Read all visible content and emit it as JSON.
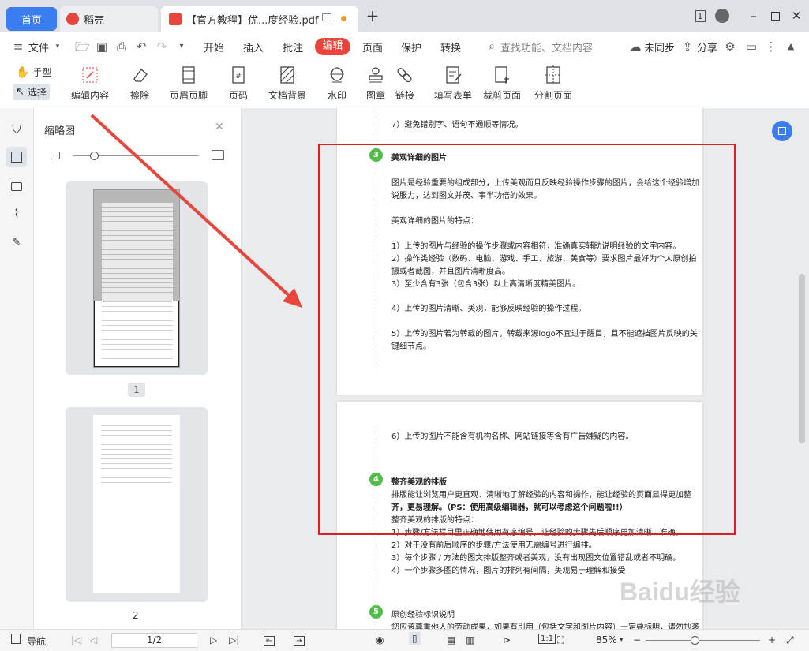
{
  "tabs": {
    "home": "首页",
    "docer": "稻壳",
    "pdf": "【官方教程】优...度经验.pdf"
  },
  "menu": {
    "file": "文件",
    "items": [
      "开始",
      "插入",
      "批注",
      "编辑",
      "页面",
      "保护",
      "转换"
    ],
    "search_placeholder": "查找功能、文档内容",
    "sync": "未同步",
    "share": "分享"
  },
  "tools": {
    "hand": "手型",
    "select": "选择",
    "ribbon": [
      "编辑内容",
      "擦除",
      "页眉页脚",
      "页码",
      "文档背景",
      "水印",
      "图章",
      "链接",
      "填写表单",
      "裁剪页面",
      "分割页面"
    ]
  },
  "thumbnail_panel": {
    "title": "缩略图",
    "page1_label": "1",
    "page2_label": "2"
  },
  "document": {
    "p1_top_line1": "7）避免错别字、语句不通顺等情况。",
    "sec3_num": "3",
    "sec3_title": "美观详细的图片",
    "sec3_p1a": "图片是经验重要的组成部分，上传美观而且反映经验操作步骤的图片，会给这个经验增加",
    "sec3_p1b": "说服力，达到图文并茂、事半功倍的效果。",
    "sec3_sub": "美观详细的图片的特点：",
    "sec3_l1": "1）上传的图片与经验的操作步骤或内容相符，准确真实辅助说明经验的文字内容。",
    "sec3_l2a": "2）操作类经验（数码、电脑、游戏、手工、旅游、美食等）要求图片最好为个人原创拍",
    "sec3_l2b": "摄或者截图，并且图片清晰度高。",
    "sec3_l3": "3）至少含有3张（包含3张）以上高清晰度精美图片。",
    "sec3_l4": "4）上传的图片清晰、美观，能够反映经验的操作过程。",
    "sec3_l5a": "5）上传的图片若为转载的图片，转载来源logo不宜过于醒目，且不能遮挡图片反映的关",
    "sec3_l5b": "键细节点。",
    "p2_l6": "6）上传的图片不能含有机构名称、网站链接等含有广告嫌疑的内容。",
    "sec4_num": "4",
    "sec4_title": "整齐美观的排版",
    "sec4_p1a": "排版能让浏览用户更直观、清晰地了解经验的内容和操作，能让经验的页面显得更加整",
    "sec4_p1b": "齐，更易理解。（PS：使用高级编辑器，就可以考虑这个问题啦!!）",
    "sec4_sub": "整齐美观的排版的特点：",
    "sec4_l1": "1）步骤/方法栏目里正确地使用有序编号，让经验的步骤先后顺序更加清晰、准确。",
    "sec4_l2": "2）对于没有前后顺序的步骤/方法使用无需编号进行编排。",
    "sec4_l3": "3）每个步骤 / 方法的图文排版整齐或者美观，没有出现图文位置错乱或者不明确。",
    "sec4_l4": "4）一个步骤多图的情况，图片的排列有间隔，美观易于理解和接受",
    "sec5_num": "5",
    "sec5_title": "原创经验标识说明",
    "sec5_p1": "您应该尊重他人的劳动成果，如果有引用（包括文字和图片内容）一定要标明，请勿抄袭"
  },
  "status": {
    "nav": "导航",
    "page": "1/2",
    "zoom": "85%"
  },
  "watermark": "Baidu经验",
  "colors": {
    "accent": "#3b7cf1",
    "edit_tab": "#e8453c",
    "section_num": "#4fbd47",
    "highlight_box": "#e02020",
    "arrow": "#e8453c"
  }
}
